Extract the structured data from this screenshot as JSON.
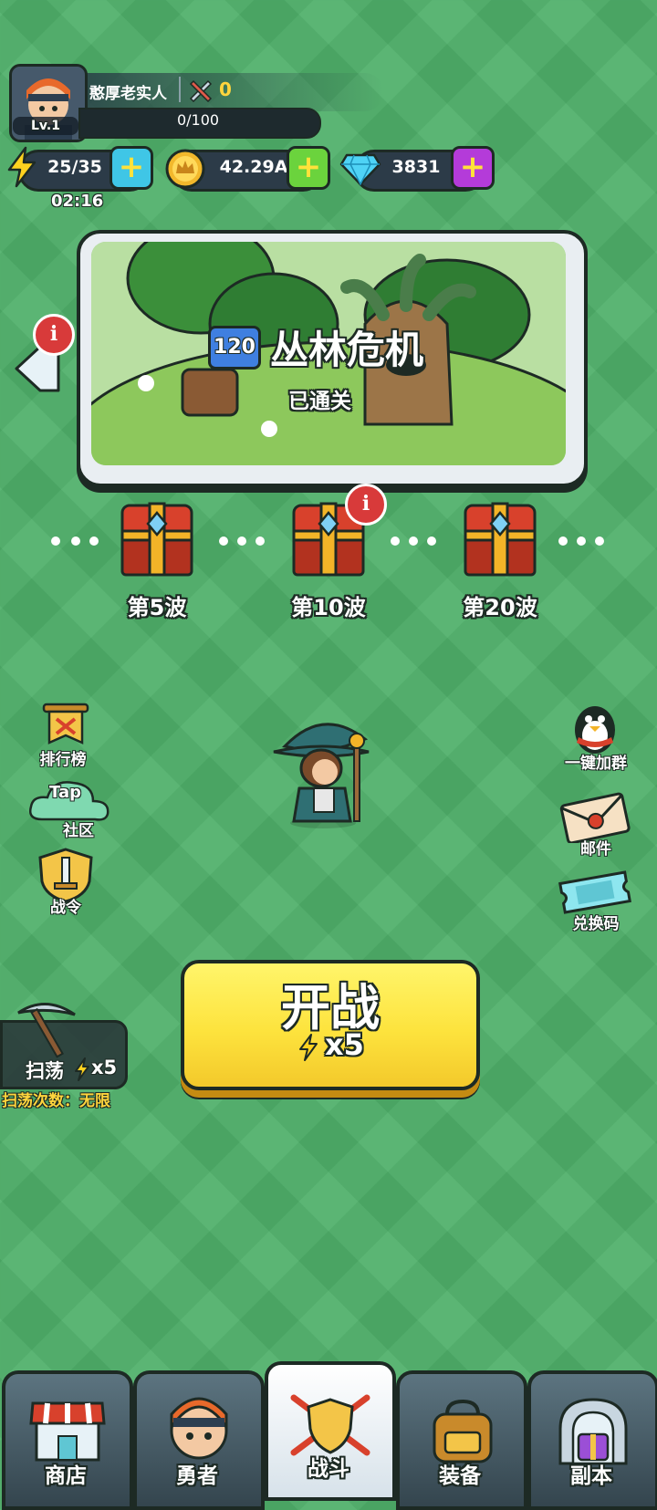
{
  "player": {
    "name": "憨厚老实人",
    "level": "Lv.1",
    "power": "0",
    "exp": "0/100"
  },
  "resources": {
    "energy": "25/35",
    "energy_timer": "02:16",
    "gold": "42.29A",
    "gems": "3831"
  },
  "stage": {
    "number": "120",
    "title": "丛林危机",
    "status": "已通关"
  },
  "waves": [
    {
      "label": "第5波"
    },
    {
      "label": "第10波"
    },
    {
      "label": "第20波"
    }
  ],
  "left_menu": {
    "ranking": "排行榜",
    "tap_logo": "Tap",
    "community": "社区",
    "battle_pass": "战令"
  },
  "right_menu": {
    "join_group": "一键加群",
    "mail": "邮件",
    "redeem": "兑换码"
  },
  "start": {
    "label": "开战",
    "cost": "x5"
  },
  "sweep": {
    "label": "扫荡",
    "cost": "x5",
    "count": "扫荡次数：无限"
  },
  "nav": {
    "shop": "商店",
    "hero": "勇者",
    "battle": "战斗",
    "equipment": "装备",
    "dungeon": "副本"
  },
  "colors": {
    "grass": "#4fb06a",
    "accent_yellow": "#fde33d",
    "outline": "#1d2a24"
  }
}
